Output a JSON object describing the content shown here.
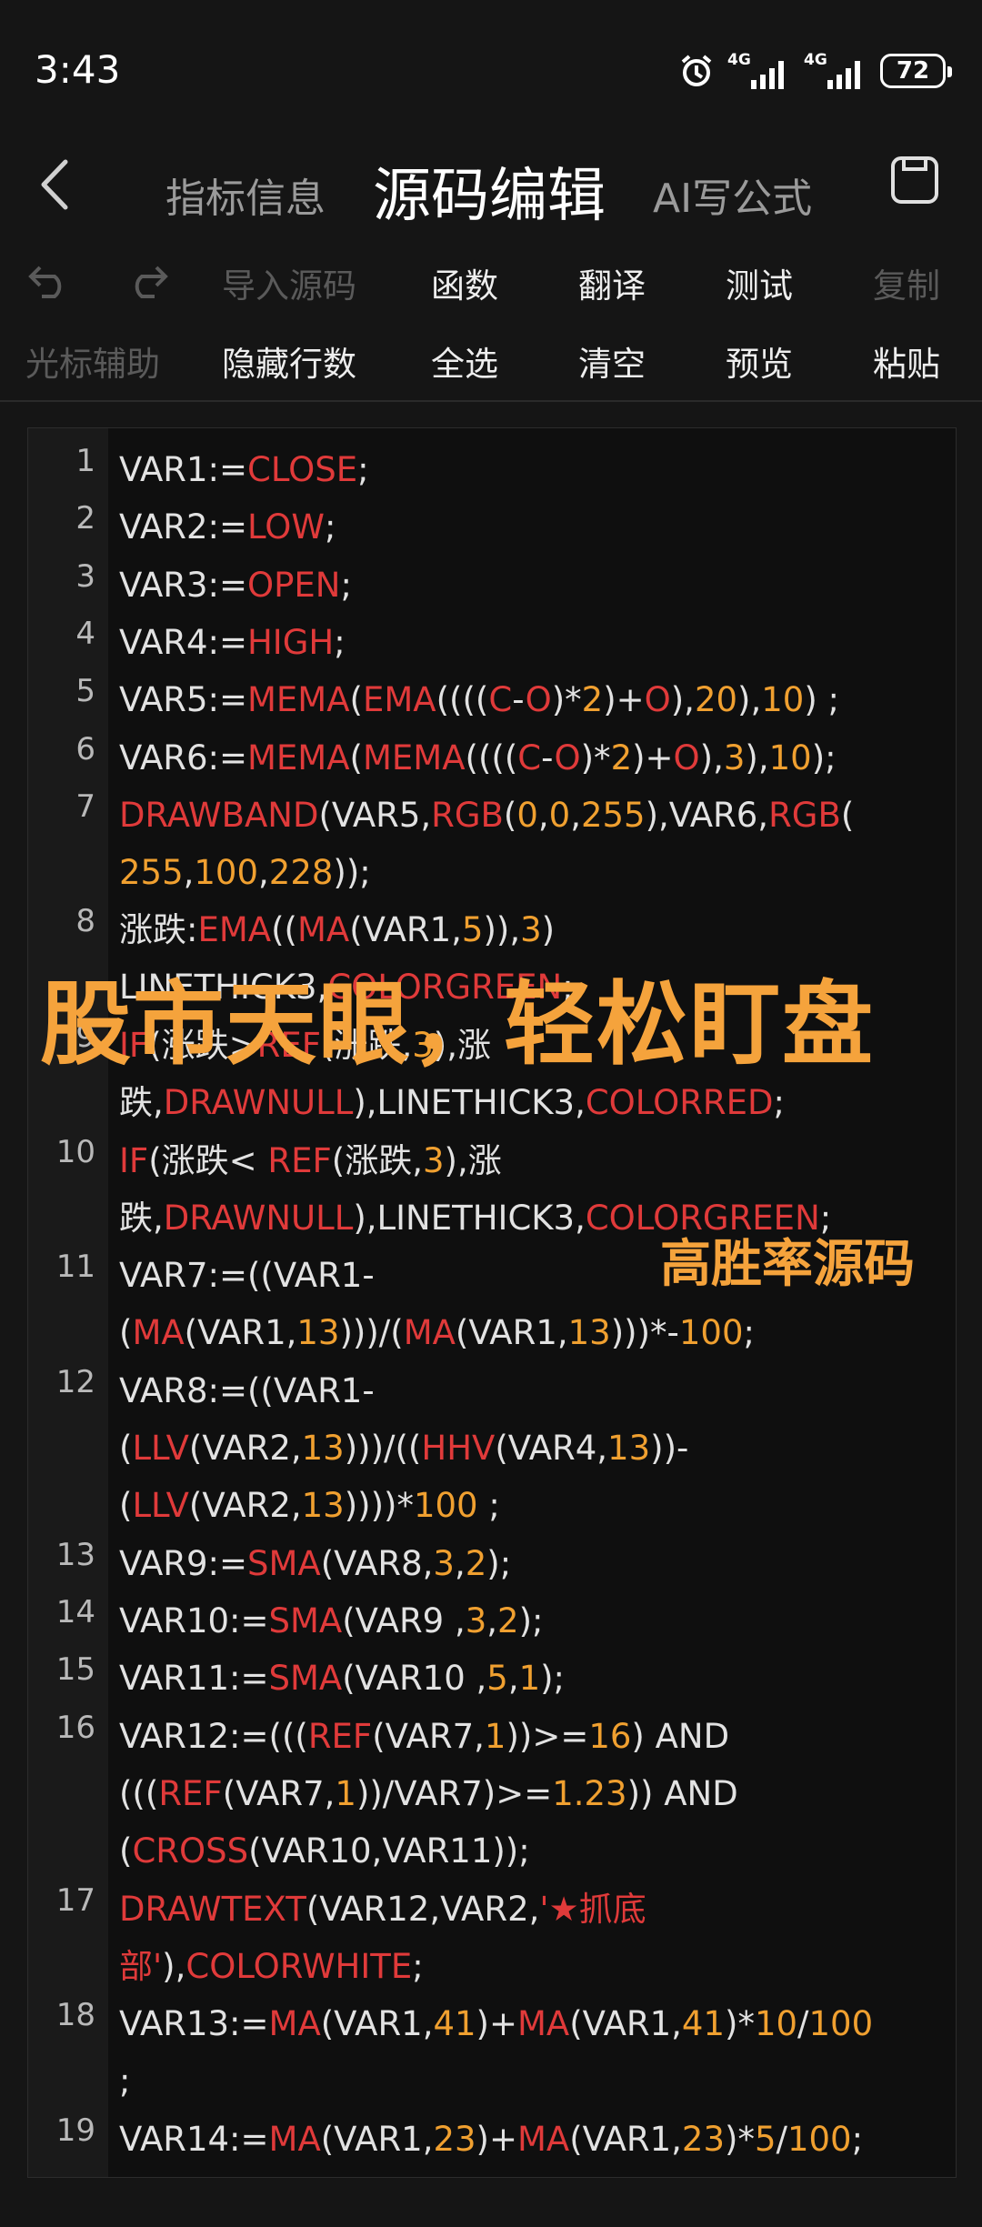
{
  "status": {
    "time": "3:43",
    "net1": "4G",
    "net2": "4G",
    "battery": "72"
  },
  "header": {
    "tab_info": "指标信息",
    "tab_source": "源码编辑",
    "tab_ai": "AI写公式"
  },
  "toolbar": {
    "import": "导入源码",
    "func": "函数",
    "translate": "翻译",
    "test": "测试",
    "copy": "复制",
    "cursor": "光标辅助",
    "hide_lines": "隐藏行数",
    "select_all": "全选",
    "clear": "清空",
    "preview": "预览",
    "paste": "粘贴"
  },
  "overlay": {
    "title": "股市天眼，轻松盯盘",
    "subtitle": "高胜率源码"
  },
  "code_lines": [
    {
      "num": "1",
      "rows": [
        [
          [
            "t",
            "VAR1:="
          ],
          [
            "k",
            "CLOSE"
          ],
          [
            "t",
            ";"
          ]
        ]
      ]
    },
    {
      "num": "2",
      "rows": [
        [
          [
            "t",
            "VAR2:="
          ],
          [
            "k",
            "LOW"
          ],
          [
            "t",
            ";"
          ]
        ]
      ]
    },
    {
      "num": "3",
      "rows": [
        [
          [
            "t",
            "VAR3:="
          ],
          [
            "k",
            "OPEN"
          ],
          [
            "t",
            ";"
          ]
        ]
      ]
    },
    {
      "num": "4",
      "rows": [
        [
          [
            "t",
            "VAR4:="
          ],
          [
            "k",
            "HIGH"
          ],
          [
            "t",
            ";"
          ]
        ]
      ]
    },
    {
      "num": "5",
      "rows": [
        [
          [
            "t",
            "VAR5:="
          ],
          [
            "k",
            "MEMA"
          ],
          [
            "t",
            "("
          ],
          [
            "k",
            "EMA"
          ],
          [
            "t",
            "(((("
          ],
          [
            "k",
            "C"
          ],
          [
            "t",
            "-"
          ],
          [
            "k",
            "O"
          ],
          [
            "t",
            ")*"
          ],
          [
            "n",
            "2"
          ],
          [
            "t",
            ")+"
          ],
          [
            "k",
            "O"
          ],
          [
            "t",
            "),"
          ],
          [
            "n",
            "20"
          ],
          [
            "t",
            "),"
          ],
          [
            "n",
            "10"
          ],
          [
            "t",
            ") ;"
          ]
        ]
      ]
    },
    {
      "num": "6",
      "rows": [
        [
          [
            "t",
            "VAR6:="
          ],
          [
            "k",
            "MEMA"
          ],
          [
            "t",
            "("
          ],
          [
            "k",
            "MEMA"
          ],
          [
            "t",
            "(((("
          ],
          [
            "k",
            "C"
          ],
          [
            "t",
            "-"
          ],
          [
            "k",
            "O"
          ],
          [
            "t",
            ")*"
          ],
          [
            "n",
            "2"
          ],
          [
            "t",
            ")+"
          ],
          [
            "k",
            "O"
          ],
          [
            "t",
            "),"
          ],
          [
            "n",
            "3"
          ],
          [
            "t",
            "),"
          ],
          [
            "n",
            "10"
          ],
          [
            "t",
            ");"
          ]
        ]
      ]
    },
    {
      "num": "7",
      "rows": [
        [
          [
            "k",
            "DRAWBAND"
          ],
          [
            "t",
            "(VAR5,"
          ],
          [
            "k",
            "RGB"
          ],
          [
            "t",
            "("
          ],
          [
            "n",
            "0"
          ],
          [
            "t",
            ","
          ],
          [
            "n",
            "0"
          ],
          [
            "t",
            ","
          ],
          [
            "n",
            "255"
          ],
          [
            "t",
            "),VAR6,"
          ],
          [
            "k",
            "RGB"
          ],
          [
            "t",
            "("
          ]
        ],
        [
          [
            "n",
            "255"
          ],
          [
            "t",
            ","
          ],
          [
            "n",
            "100"
          ],
          [
            "t",
            ","
          ],
          [
            "n",
            "228"
          ],
          [
            "t",
            "));"
          ]
        ]
      ]
    },
    {
      "num": "8",
      "rows": [
        [
          [
            "t",
            "涨跌:"
          ],
          [
            "k",
            "EMA"
          ],
          [
            "t",
            "(("
          ],
          [
            "k",
            "MA"
          ],
          [
            "t",
            "(VAR1,"
          ],
          [
            "n",
            "5"
          ],
          [
            "t",
            ")),"
          ],
          [
            "n",
            "3"
          ],
          [
            "t",
            ")"
          ]
        ],
        [
          [
            "t",
            "LINETHICK3,"
          ],
          [
            "k",
            "COLORGREEN"
          ],
          [
            "t",
            ";"
          ]
        ]
      ]
    },
    {
      "num": "9",
      "rows": [
        [
          [
            "k",
            "IF"
          ],
          [
            "t",
            "(涨跌>"
          ],
          [
            "k",
            "REF"
          ],
          [
            "t",
            "(涨跌,"
          ],
          [
            "n",
            "3"
          ],
          [
            "t",
            "),涨"
          ]
        ],
        [
          [
            "t",
            "跌,"
          ],
          [
            "k",
            "DRAWNULL"
          ],
          [
            "t",
            "),LINETHICK3,"
          ],
          [
            "k",
            "COLORRED"
          ],
          [
            "t",
            ";"
          ]
        ]
      ]
    },
    {
      "num": "10",
      "rows": [
        [
          [
            "k",
            "IF"
          ],
          [
            "t",
            "(涨跌< "
          ],
          [
            "k",
            "REF"
          ],
          [
            "t",
            "(涨跌,"
          ],
          [
            "n",
            "3"
          ],
          [
            "t",
            "),涨"
          ]
        ],
        [
          [
            "t",
            "跌,"
          ],
          [
            "k",
            "DRAWNULL"
          ],
          [
            "t",
            "),LINETHICK3,"
          ],
          [
            "k",
            "COLORGREEN"
          ],
          [
            "t",
            ";"
          ]
        ]
      ]
    },
    {
      "num": "11",
      "rows": [
        [
          [
            "t",
            "VAR7:=((VAR1-"
          ]
        ],
        [
          [
            "t",
            "("
          ],
          [
            "k",
            "MA"
          ],
          [
            "t",
            "(VAR1,"
          ],
          [
            "n",
            "13"
          ],
          [
            "t",
            ")))/("
          ],
          [
            "k",
            "MA"
          ],
          [
            "t",
            "(VAR1,"
          ],
          [
            "n",
            "13"
          ],
          [
            "t",
            ")))*-"
          ],
          [
            "n",
            "100"
          ],
          [
            "t",
            ";"
          ]
        ]
      ]
    },
    {
      "num": "12",
      "rows": [
        [
          [
            "t",
            "VAR8:=((VAR1-"
          ]
        ],
        [
          [
            "t",
            "("
          ],
          [
            "k",
            "LLV"
          ],
          [
            "t",
            "(VAR2,"
          ],
          [
            "n",
            "13"
          ],
          [
            "t",
            ")))/(("
          ],
          [
            "k",
            "HHV"
          ],
          [
            "t",
            "(VAR4,"
          ],
          [
            "n",
            "13"
          ],
          [
            "t",
            "))-"
          ]
        ],
        [
          [
            "t",
            "("
          ],
          [
            "k",
            "LLV"
          ],
          [
            "t",
            "(VAR2,"
          ],
          [
            "n",
            "13"
          ],
          [
            "t",
            "))))*"
          ],
          [
            "n",
            "100"
          ],
          [
            "t",
            " ;"
          ]
        ]
      ]
    },
    {
      "num": "13",
      "rows": [
        [
          [
            "t",
            "VAR9:="
          ],
          [
            "k",
            "SMA"
          ],
          [
            "t",
            "(VAR8,"
          ],
          [
            "n",
            "3"
          ],
          [
            "t",
            ","
          ],
          [
            "n",
            "2"
          ],
          [
            "t",
            ");"
          ]
        ]
      ]
    },
    {
      "num": "14",
      "rows": [
        [
          [
            "t",
            "VAR10:="
          ],
          [
            "k",
            "SMA"
          ],
          [
            "t",
            "(VAR9 ,"
          ],
          [
            "n",
            "3"
          ],
          [
            "t",
            ","
          ],
          [
            "n",
            "2"
          ],
          [
            "t",
            ");"
          ]
        ]
      ]
    },
    {
      "num": "15",
      "rows": [
        [
          [
            "t",
            "VAR11:="
          ],
          [
            "k",
            "SMA"
          ],
          [
            "t",
            "(VAR10 ,"
          ],
          [
            "n",
            "5"
          ],
          [
            "t",
            ","
          ],
          [
            "n",
            "1"
          ],
          [
            "t",
            ");"
          ]
        ]
      ]
    },
    {
      "num": "16",
      "rows": [
        [
          [
            "t",
            "VAR12:=((("
          ],
          [
            "k",
            "REF"
          ],
          [
            "t",
            "(VAR7,"
          ],
          [
            "n",
            "1"
          ],
          [
            "t",
            "))>="
          ],
          [
            "n",
            "16"
          ],
          [
            "t",
            ") AND"
          ]
        ],
        [
          [
            "t",
            "((("
          ],
          [
            "k",
            "REF"
          ],
          [
            "t",
            "(VAR7,"
          ],
          [
            "n",
            "1"
          ],
          [
            "t",
            "))/VAR7)>="
          ],
          [
            "n",
            "1.23"
          ],
          [
            "t",
            ")) AND"
          ]
        ],
        [
          [
            "t",
            "("
          ],
          [
            "k",
            "CROSS"
          ],
          [
            "t",
            "(VAR10,VAR11));"
          ]
        ]
      ]
    },
    {
      "num": "17",
      "rows": [
        [
          [
            "k",
            "DRAWTEXT"
          ],
          [
            "t",
            "(VAR12,VAR2,"
          ],
          [
            "k",
            "'★抓底"
          ]
        ],
        [
          [
            "k",
            "部'"
          ],
          [
            "t",
            "),"
          ],
          [
            "k",
            "COLORWHITE"
          ],
          [
            "t",
            ";"
          ]
        ]
      ]
    },
    {
      "num": "18",
      "rows": [
        [
          [
            "t",
            "VAR13:="
          ],
          [
            "k",
            "MA"
          ],
          [
            "t",
            "(VAR1,"
          ],
          [
            "n",
            "41"
          ],
          [
            "t",
            ")+"
          ],
          [
            "k",
            "MA"
          ],
          [
            "t",
            "(VAR1,"
          ],
          [
            "n",
            "41"
          ],
          [
            "t",
            ")*"
          ],
          [
            "n",
            "10"
          ],
          [
            "t",
            "/"
          ],
          [
            "n",
            "100"
          ]
        ],
        [
          [
            "t",
            ";"
          ]
        ]
      ]
    },
    {
      "num": "19",
      "rows": [
        [
          [
            "t",
            "VAR14:="
          ],
          [
            "k",
            "MA"
          ],
          [
            "t",
            "(VAR1,"
          ],
          [
            "n",
            "23"
          ],
          [
            "t",
            ")+"
          ],
          [
            "k",
            "MA"
          ],
          [
            "t",
            "(VAR1,"
          ],
          [
            "n",
            "23"
          ],
          [
            "t",
            ")*"
          ],
          [
            "n",
            "5"
          ],
          [
            "t",
            "/"
          ],
          [
            "n",
            "100"
          ],
          [
            "t",
            ";"
          ]
        ]
      ]
    }
  ]
}
